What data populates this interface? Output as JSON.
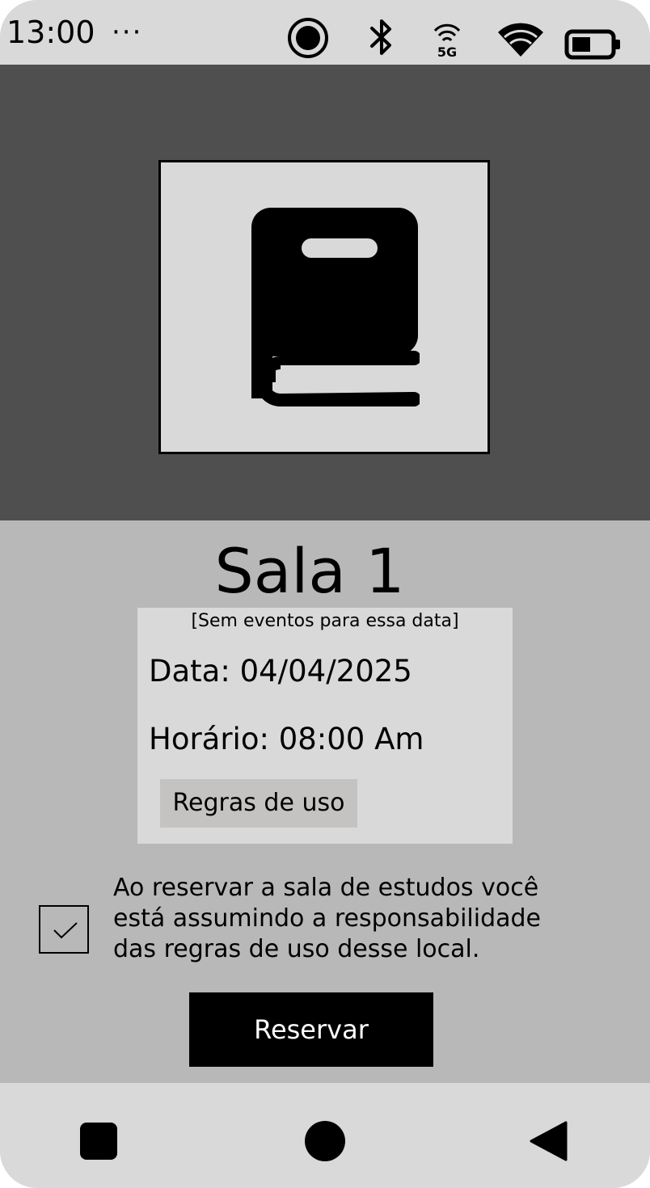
{
  "status_bar": {
    "time": "13:00",
    "more_indicator": "···",
    "icons": [
      "record-icon",
      "bluetooth-icon",
      "5g-icon",
      "wifi-icon",
      "battery-icon"
    ],
    "network_label": "5G"
  },
  "hero": {
    "image_icon": "book-icon"
  },
  "room": {
    "title": "Sala 1",
    "note": "[Sem eventos para essa data]",
    "date_line": "Data: 04/04/2025",
    "time_line": "Horário: 08:00 Am",
    "rules_button_label": "Regras de uso"
  },
  "consent": {
    "checked": true,
    "text": "Ao reservar a sala de estudos você está assumindo a responsabilidade das regras de uso desse local."
  },
  "actions": {
    "reserve_label": "Reservar"
  },
  "nav_bar": {
    "icons": [
      "recents-square-icon",
      "home-circle-icon",
      "back-triangle-icon"
    ]
  },
  "colors": {
    "hero_background": "#504f50",
    "content_background": "#b8b8b8",
    "card_background": "#d9d9d9",
    "rules_button": "#c5c2c2",
    "reserve_button": "#000000"
  }
}
